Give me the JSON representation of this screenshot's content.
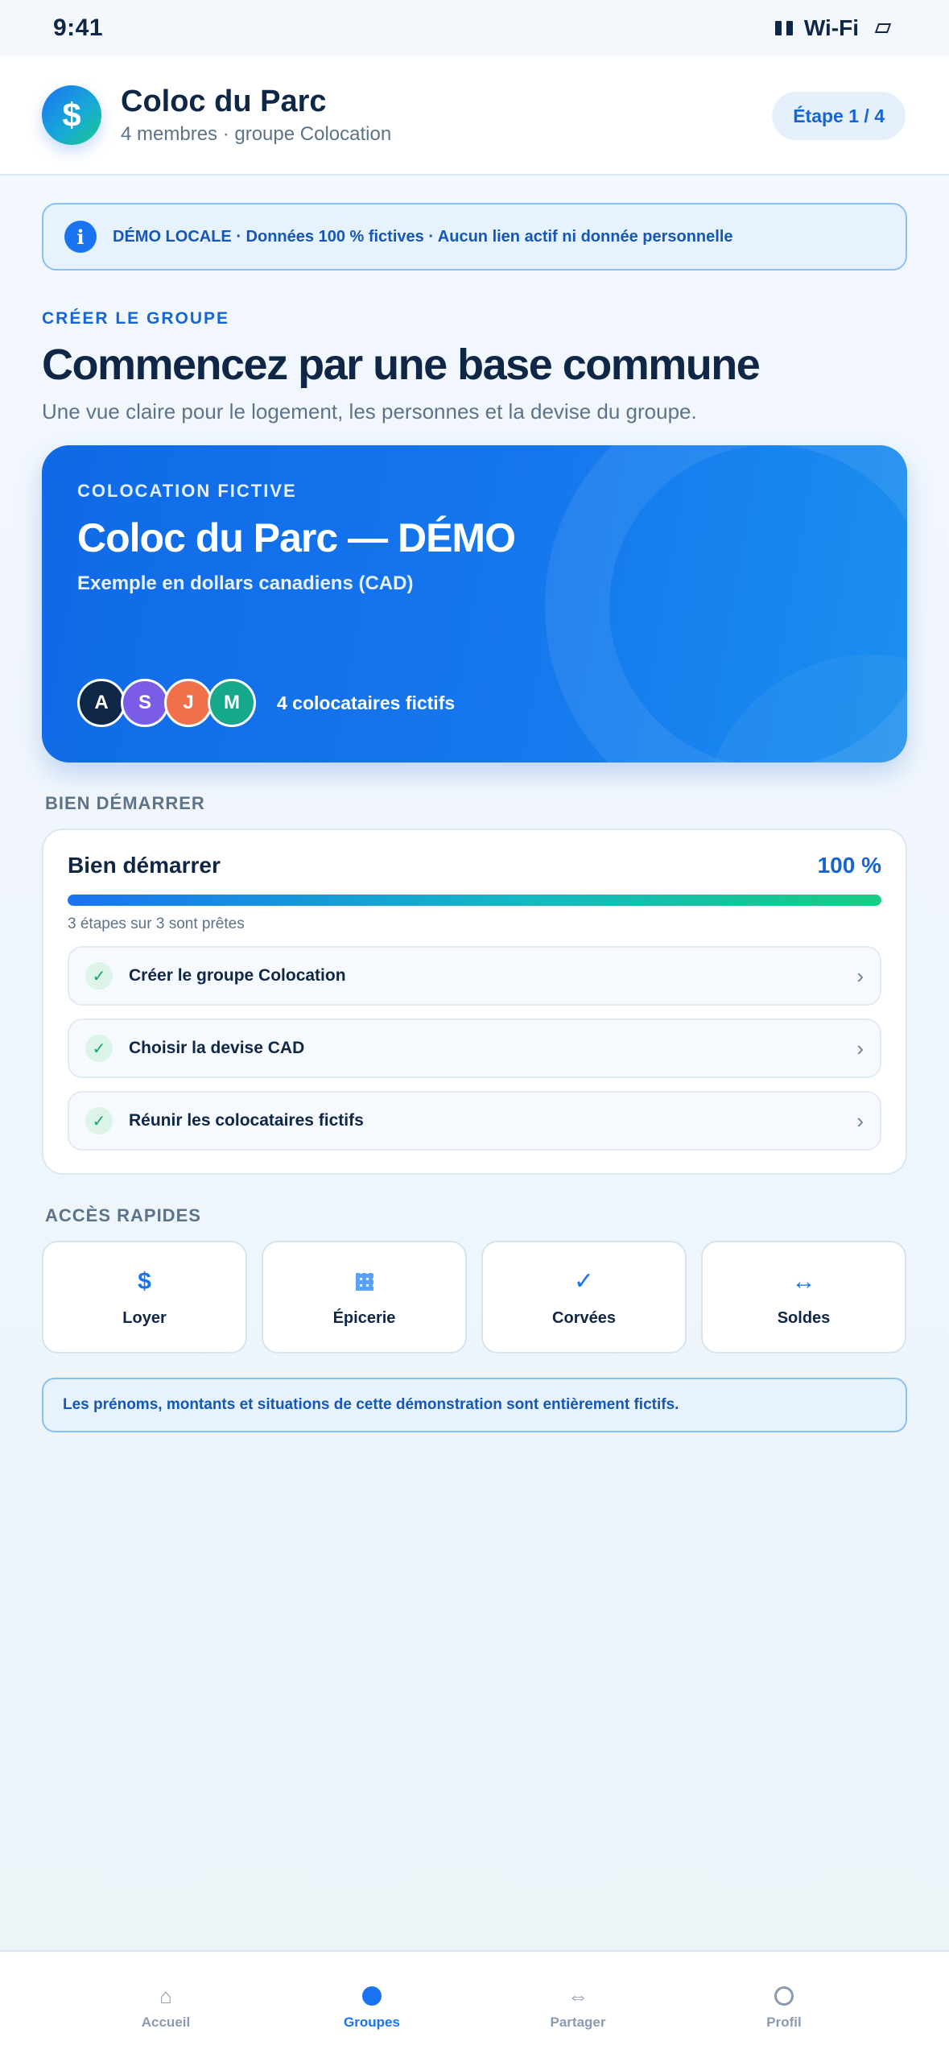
{
  "status_bar": {
    "time": "9:41",
    "wifi": "Wi-Fi"
  },
  "header": {
    "logo_glyph": "$",
    "title": "Coloc du Parc",
    "subtitle": "4 membres · groupe Colocation",
    "step": "Étape 1 / 4"
  },
  "banner": {
    "icon": "info-icon",
    "text": "DÉMO LOCALE · Données 100 % fictives · Aucun lien actif ni donnée personnelle"
  },
  "intro": {
    "eyebrow": "CRÉER LE GROUPE",
    "title": "Commencez par une base commune",
    "subtitle": "Une vue claire pour le logement, les personnes et la devise du groupe."
  },
  "hero": {
    "eyebrow": "COLOCATION FICTIVE",
    "title": "Coloc du Parc — DÉMO",
    "subtitle": "Exemple en dollars canadiens (CAD)",
    "avatars": [
      {
        "initial": "A",
        "color": "#0f2747"
      },
      {
        "initial": "S",
        "color": "#7b5ce6"
      },
      {
        "initial": "J",
        "color": "#f0704a"
      },
      {
        "initial": "M",
        "color": "#16a88a"
      }
    ],
    "members_text": "4 colocataires fictifs"
  },
  "getting_started": {
    "section_label": "BIEN DÉMARRER",
    "title": "Bien démarrer",
    "percent_label": "100 %",
    "progress": 1.0,
    "caption": "3 étapes sur 3 sont prêtes",
    "tasks": [
      {
        "label": "Créer le groupe Colocation",
        "done": true
      },
      {
        "label": "Choisir la devise CAD",
        "done": true
      },
      {
        "label": "Réunir les colocataires fictifs",
        "done": true
      }
    ],
    "check_glyph": "✓",
    "chevron_glyph": "›"
  },
  "quick_access": {
    "section_label": "ACCÈS RAPIDES",
    "items": [
      {
        "label": "Loyer",
        "icon": "dollar-icon",
        "glyph": "$"
      },
      {
        "label": "Épicerie",
        "icon": "grid-icon",
        "glyph": ""
      },
      {
        "label": "Corvées",
        "icon": "check-icon",
        "glyph": "✓"
      },
      {
        "label": "Soldes",
        "icon": "swap-icon",
        "glyph": "↔"
      }
    ]
  },
  "footer_note": "Les prénoms, montants et situations de cette démonstration sont entièrement fictifs.",
  "tabbar": {
    "items": [
      {
        "label": "Accueil",
        "icon": "home-icon",
        "glyph": "⌂"
      },
      {
        "label": "Groupes",
        "icon": "groups-icon",
        "active": true
      },
      {
        "label": "Partager",
        "icon": "share-icon",
        "glyph": "⇔"
      },
      {
        "label": "Profil",
        "icon": "profile-icon"
      }
    ]
  },
  "colors": {
    "accent": "#1a73f0",
    "navy": "#0f2747",
    "success": "#16a765"
  }
}
